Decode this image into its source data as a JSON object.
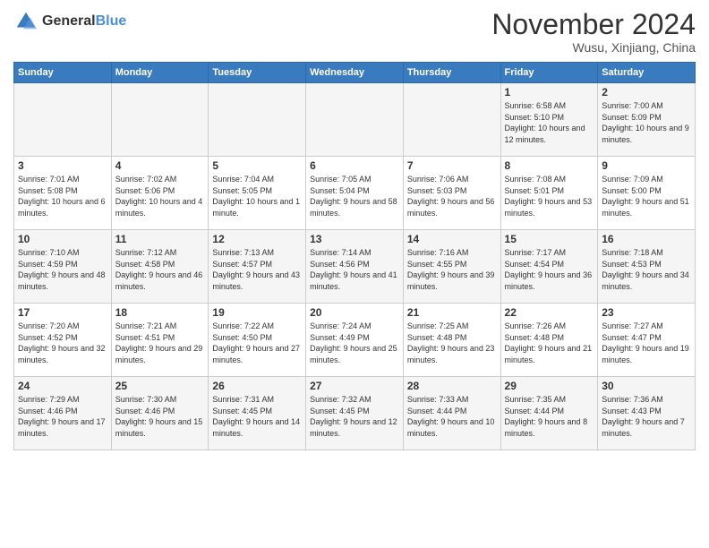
{
  "logo": {
    "line1": "General",
    "line2": "Blue"
  },
  "header": {
    "month": "November 2024",
    "location": "Wusu, Xinjiang, China"
  },
  "weekdays": [
    "Sunday",
    "Monday",
    "Tuesday",
    "Wednesday",
    "Thursday",
    "Friday",
    "Saturday"
  ],
  "weeks": [
    [
      {
        "day": "",
        "sunrise": "",
        "sunset": "",
        "daylight": ""
      },
      {
        "day": "",
        "sunrise": "",
        "sunset": "",
        "daylight": ""
      },
      {
        "day": "",
        "sunrise": "",
        "sunset": "",
        "daylight": ""
      },
      {
        "day": "",
        "sunrise": "",
        "sunset": "",
        "daylight": ""
      },
      {
        "day": "",
        "sunrise": "",
        "sunset": "",
        "daylight": ""
      },
      {
        "day": "1",
        "sunrise": "Sunrise: 6:58 AM",
        "sunset": "Sunset: 5:10 PM",
        "daylight": "Daylight: 10 hours and 12 minutes."
      },
      {
        "day": "2",
        "sunrise": "Sunrise: 7:00 AM",
        "sunset": "Sunset: 5:09 PM",
        "daylight": "Daylight: 10 hours and 9 minutes."
      }
    ],
    [
      {
        "day": "3",
        "sunrise": "Sunrise: 7:01 AM",
        "sunset": "Sunset: 5:08 PM",
        "daylight": "Daylight: 10 hours and 6 minutes."
      },
      {
        "day": "4",
        "sunrise": "Sunrise: 7:02 AM",
        "sunset": "Sunset: 5:06 PM",
        "daylight": "Daylight: 10 hours and 4 minutes."
      },
      {
        "day": "5",
        "sunrise": "Sunrise: 7:04 AM",
        "sunset": "Sunset: 5:05 PM",
        "daylight": "Daylight: 10 hours and 1 minute."
      },
      {
        "day": "6",
        "sunrise": "Sunrise: 7:05 AM",
        "sunset": "Sunset: 5:04 PM",
        "daylight": "Daylight: 9 hours and 58 minutes."
      },
      {
        "day": "7",
        "sunrise": "Sunrise: 7:06 AM",
        "sunset": "Sunset: 5:03 PM",
        "daylight": "Daylight: 9 hours and 56 minutes."
      },
      {
        "day": "8",
        "sunrise": "Sunrise: 7:08 AM",
        "sunset": "Sunset: 5:01 PM",
        "daylight": "Daylight: 9 hours and 53 minutes."
      },
      {
        "day": "9",
        "sunrise": "Sunrise: 7:09 AM",
        "sunset": "Sunset: 5:00 PM",
        "daylight": "Daylight: 9 hours and 51 minutes."
      }
    ],
    [
      {
        "day": "10",
        "sunrise": "Sunrise: 7:10 AM",
        "sunset": "Sunset: 4:59 PM",
        "daylight": "Daylight: 9 hours and 48 minutes."
      },
      {
        "day": "11",
        "sunrise": "Sunrise: 7:12 AM",
        "sunset": "Sunset: 4:58 PM",
        "daylight": "Daylight: 9 hours and 46 minutes."
      },
      {
        "day": "12",
        "sunrise": "Sunrise: 7:13 AM",
        "sunset": "Sunset: 4:57 PM",
        "daylight": "Daylight: 9 hours and 43 minutes."
      },
      {
        "day": "13",
        "sunrise": "Sunrise: 7:14 AM",
        "sunset": "Sunset: 4:56 PM",
        "daylight": "Daylight: 9 hours and 41 minutes."
      },
      {
        "day": "14",
        "sunrise": "Sunrise: 7:16 AM",
        "sunset": "Sunset: 4:55 PM",
        "daylight": "Daylight: 9 hours and 39 minutes."
      },
      {
        "day": "15",
        "sunrise": "Sunrise: 7:17 AM",
        "sunset": "Sunset: 4:54 PM",
        "daylight": "Daylight: 9 hours and 36 minutes."
      },
      {
        "day": "16",
        "sunrise": "Sunrise: 7:18 AM",
        "sunset": "Sunset: 4:53 PM",
        "daylight": "Daylight: 9 hours and 34 minutes."
      }
    ],
    [
      {
        "day": "17",
        "sunrise": "Sunrise: 7:20 AM",
        "sunset": "Sunset: 4:52 PM",
        "daylight": "Daylight: 9 hours and 32 minutes."
      },
      {
        "day": "18",
        "sunrise": "Sunrise: 7:21 AM",
        "sunset": "Sunset: 4:51 PM",
        "daylight": "Daylight: 9 hours and 29 minutes."
      },
      {
        "day": "19",
        "sunrise": "Sunrise: 7:22 AM",
        "sunset": "Sunset: 4:50 PM",
        "daylight": "Daylight: 9 hours and 27 minutes."
      },
      {
        "day": "20",
        "sunrise": "Sunrise: 7:24 AM",
        "sunset": "Sunset: 4:49 PM",
        "daylight": "Daylight: 9 hours and 25 minutes."
      },
      {
        "day": "21",
        "sunrise": "Sunrise: 7:25 AM",
        "sunset": "Sunset: 4:48 PM",
        "daylight": "Daylight: 9 hours and 23 minutes."
      },
      {
        "day": "22",
        "sunrise": "Sunrise: 7:26 AM",
        "sunset": "Sunset: 4:48 PM",
        "daylight": "Daylight: 9 hours and 21 minutes."
      },
      {
        "day": "23",
        "sunrise": "Sunrise: 7:27 AM",
        "sunset": "Sunset: 4:47 PM",
        "daylight": "Daylight: 9 hours and 19 minutes."
      }
    ],
    [
      {
        "day": "24",
        "sunrise": "Sunrise: 7:29 AM",
        "sunset": "Sunset: 4:46 PM",
        "daylight": "Daylight: 9 hours and 17 minutes."
      },
      {
        "day": "25",
        "sunrise": "Sunrise: 7:30 AM",
        "sunset": "Sunset: 4:46 PM",
        "daylight": "Daylight: 9 hours and 15 minutes."
      },
      {
        "day": "26",
        "sunrise": "Sunrise: 7:31 AM",
        "sunset": "Sunset: 4:45 PM",
        "daylight": "Daylight: 9 hours and 14 minutes."
      },
      {
        "day": "27",
        "sunrise": "Sunrise: 7:32 AM",
        "sunset": "Sunset: 4:45 PM",
        "daylight": "Daylight: 9 hours and 12 minutes."
      },
      {
        "day": "28",
        "sunrise": "Sunrise: 7:33 AM",
        "sunset": "Sunset: 4:44 PM",
        "daylight": "Daylight: 9 hours and 10 minutes."
      },
      {
        "day": "29",
        "sunrise": "Sunrise: 7:35 AM",
        "sunset": "Sunset: 4:44 PM",
        "daylight": "Daylight: 9 hours and 8 minutes."
      },
      {
        "day": "30",
        "sunrise": "Sunrise: 7:36 AM",
        "sunset": "Sunset: 4:43 PM",
        "daylight": "Daylight: 9 hours and 7 minutes."
      }
    ]
  ]
}
